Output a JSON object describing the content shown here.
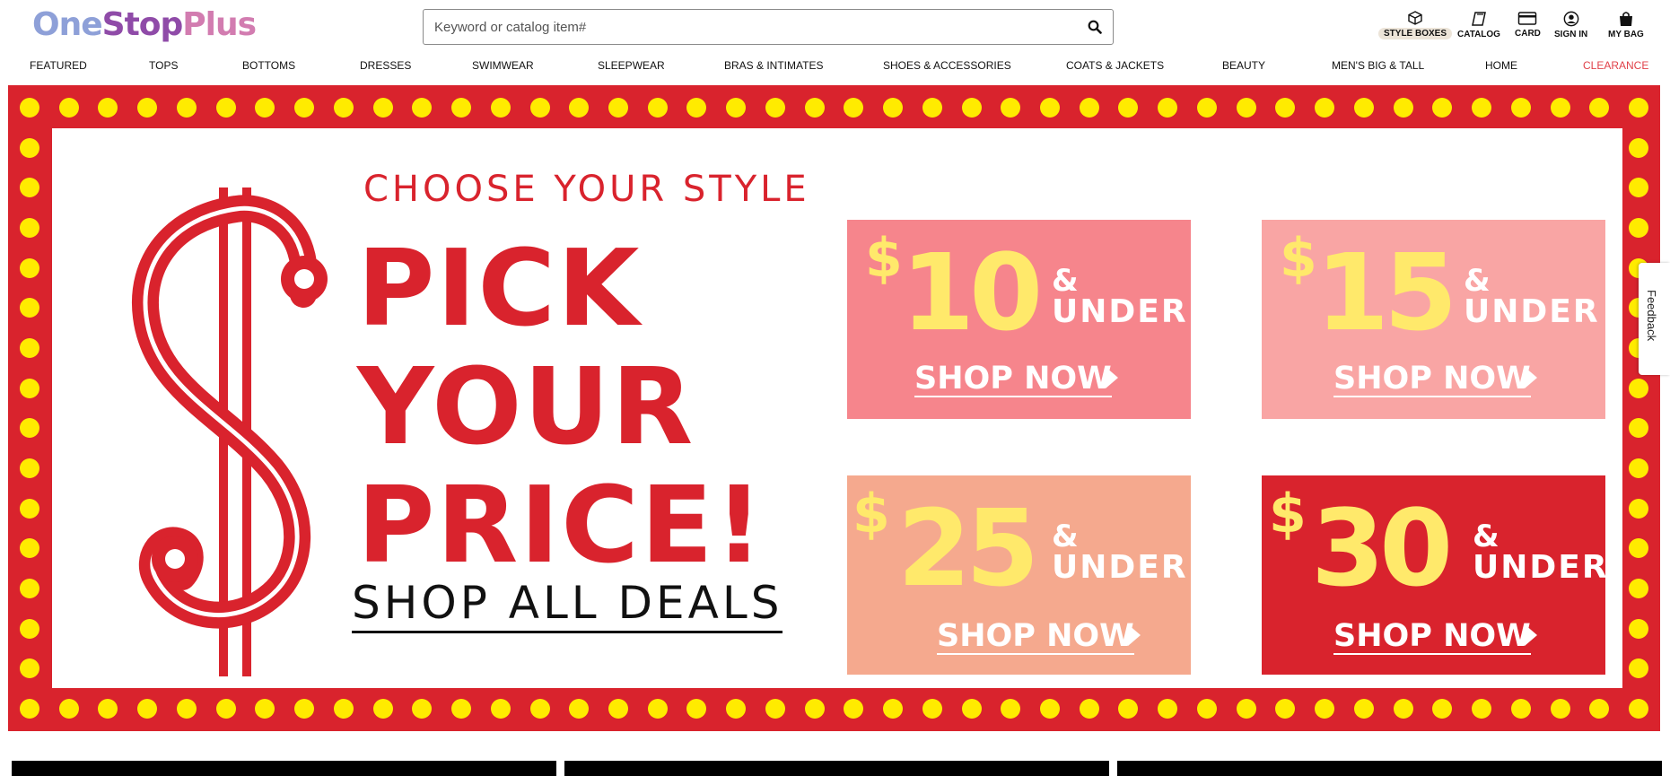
{
  "header": {
    "logo": {
      "part1": "One",
      "part2": "Stop",
      "part3": "Plus"
    },
    "search": {
      "placeholder": "Keyword or catalog item#",
      "value": ""
    },
    "utility": {
      "style_boxes": "STYLE BOXES",
      "catalog": "CATALOG",
      "card": "CARD",
      "sign_in": "SIGN IN",
      "my_bag": "MY BAG"
    }
  },
  "nav": {
    "items": [
      "FEATURED",
      "TOPS",
      "BOTTOMS",
      "DRESSES",
      "SWIMWEAR",
      "SLEEPWEAR",
      "BRAS & INTIMATES",
      "SHOES & ACCESSORIES",
      "COATS & JACKETS",
      "BEAUTY",
      "MEN'S BIG & TALL",
      "HOME",
      "CLEARANCE"
    ]
  },
  "hero": {
    "choose": "CHOOSE YOUR STYLE",
    "pick_line1": "PICK",
    "pick_line2": "YOUR",
    "pick_line3": "PRICE!",
    "shop_all": "SHOP ALL DEALS",
    "tiles": [
      {
        "currency": "$",
        "amount": "10",
        "amp": "&",
        "under": "UNDER",
        "shop": "SHOP NOW",
        "bg": "#f6858c"
      },
      {
        "currency": "$",
        "amount": "15",
        "amp": "&",
        "under": "UNDER",
        "shop": "SHOP NOW",
        "bg": "#f9a5a4"
      },
      {
        "currency": "$",
        "amount": "25",
        "amp": "&",
        "under": "UNDER",
        "shop": "SHOP NOW",
        "bg": "#f5a98e"
      },
      {
        "currency": "$",
        "amount": "30",
        "amp": "&",
        "under": "UNDER",
        "shop": "SHOP NOW",
        "bg": "#d9232d"
      }
    ]
  },
  "feedback": "Feedback",
  "colors": {
    "brand_red": "#d9232d",
    "dot_yellow": "#ffeb00",
    "price_yellow": "#ffe96b",
    "clearance": "#e0424a"
  }
}
